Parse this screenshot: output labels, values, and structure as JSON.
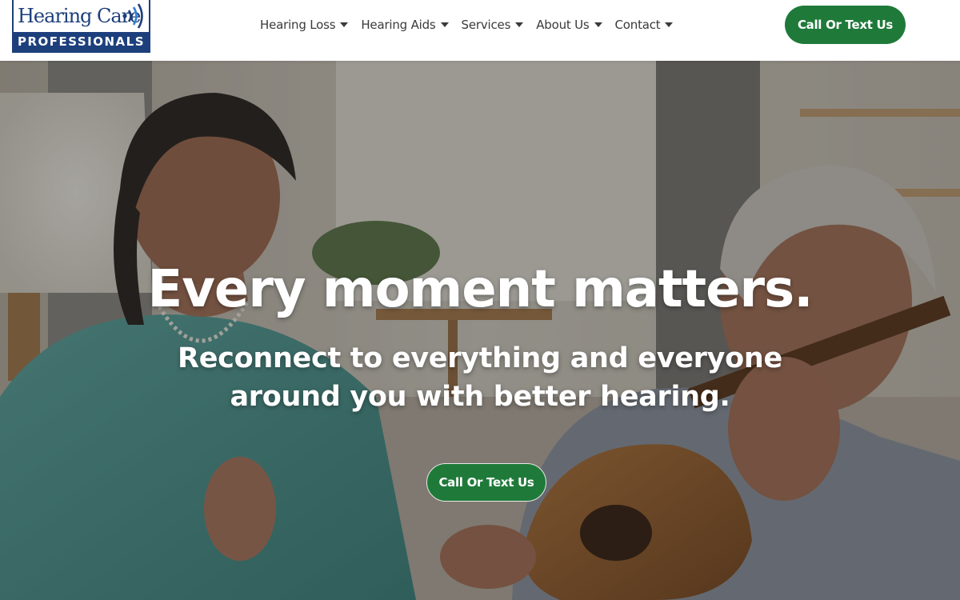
{
  "header": {
    "logo": {
      "top_text": "Hearing Care",
      "bottom_text": "PROFESSIONALS",
      "icon": "sound-waves-icon"
    },
    "nav": [
      {
        "label": "Hearing Loss",
        "icon": "caret-down-icon"
      },
      {
        "label": "Hearing Aids",
        "icon": "caret-down-icon"
      },
      {
        "label": "Services",
        "icon": "caret-down-icon"
      },
      {
        "label": "About Us",
        "icon": "caret-down-icon"
      },
      {
        "label": "Contact",
        "icon": "caret-down-icon"
      }
    ],
    "cta_label": "Call Or Text Us"
  },
  "hero": {
    "title": "Every moment matters.",
    "subtitle": "Reconnect to everything and everyone around you with better hearing.",
    "cta_label": "Call Or Text Us",
    "image": "photo of a woman clapping beside a man playing acoustic guitar"
  },
  "colors": {
    "brand_blue": "#1d3f7c",
    "cta_green": "#1f7a3a",
    "nav_text": "#3a3a3a",
    "hero_text": "#ffffff"
  }
}
